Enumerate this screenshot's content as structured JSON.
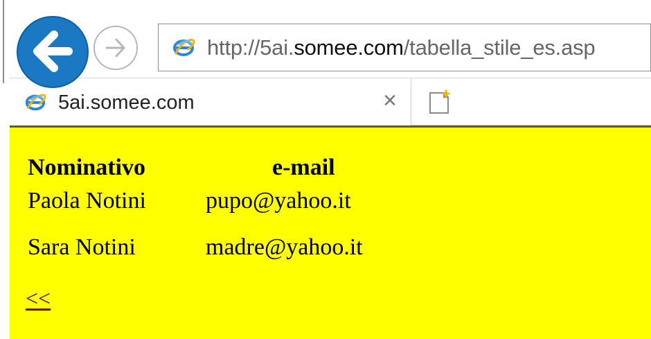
{
  "browser": {
    "address": {
      "prefix": "http://5ai.",
      "domain": "somee.com",
      "path": "/tabella_stile_es.asp"
    },
    "tab": {
      "title": "5ai.somee.com",
      "close_label": "×"
    },
    "icons": {
      "back": "back-arrow-icon",
      "forward": "forward-arrow-icon",
      "browser": "internet-explorer-icon",
      "new_tab": "new-tab-icon",
      "close": "close-icon"
    }
  },
  "page": {
    "background_color": "#ffff00",
    "table": {
      "headers": [
        "Nominativo",
        "e-mail"
      ],
      "rows": [
        [
          "Paola Notini",
          "pupo@yahoo.it"
        ],
        [
          "Sara Notini",
          "madre@yahoo.it"
        ]
      ]
    },
    "back_link": "<<"
  }
}
